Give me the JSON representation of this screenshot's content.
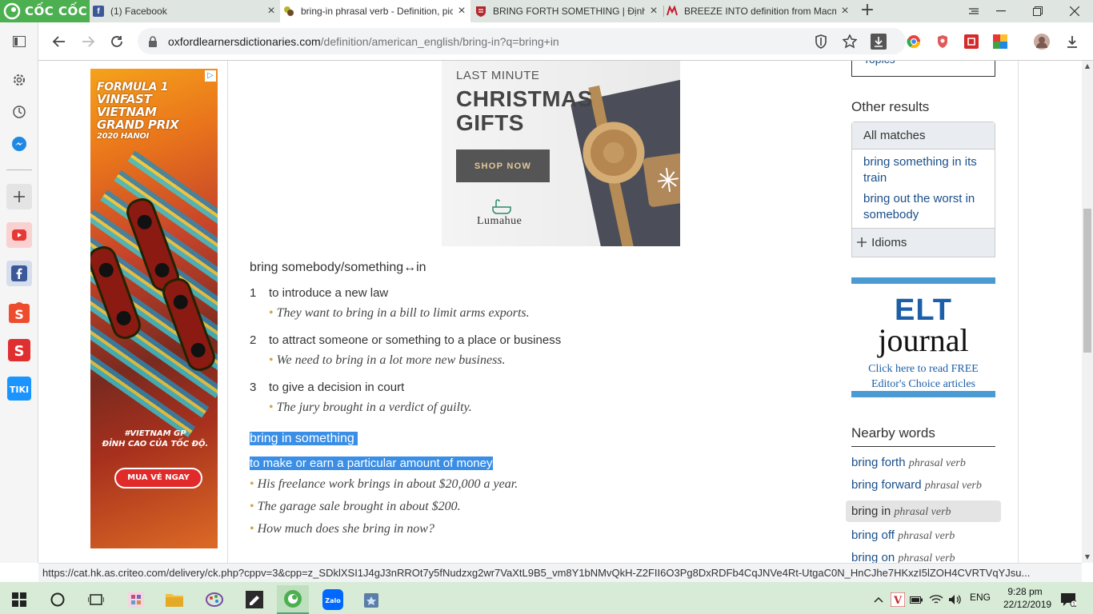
{
  "browser": {
    "brand": "CỐC CỐC",
    "tabs": [
      {
        "title": "(1) Facebook",
        "favicon": "facebook-icon",
        "active": false
      },
      {
        "title": "bring-in phrasal verb - Definition, pictures, pronunciation",
        "favicon": "oxford-icon",
        "active": true
      },
      {
        "title": "BRING FORTH SOMETHING | Định nghĩa",
        "favicon": "cambridge-icon",
        "active": false
      },
      {
        "title": "BREEZE INTO definition from Macmillan",
        "favicon": "macmillan-icon",
        "active": false
      }
    ],
    "url_domain": "oxfordlearnersdictionaries.com",
    "url_path": "/definition/american_english/bring-in?q=bring+in",
    "status_url": "https://cat.hk.as.criteo.com/delivery/ck.php?cppv=3&cpp=z_SDklXSI1J4gJ3nRROt7y5fNudzxg2wr7VaXtL9B5_vm8Y1bNMvQkH-Z2FII6O3Pg8DxRDFb4CqJNVe4Rt-UtgaC0N_HnCJhe7HKxzI5lZOH4CVRTVqYJsu..."
  },
  "ads": {
    "f1": {
      "title_lines": [
        "FORMULA 1",
        "VINFAST",
        "VIETNAM",
        "GRAND PRIX",
        "2020 HANOI"
      ],
      "tagline": "#VIETNAM GP\nĐỈNH CAO CỦA TỐC ĐỘ.",
      "cta": "MUA VÉ NGAY"
    },
    "xmas": {
      "line1": "LAST MINUTE",
      "line2": "CHRISTMAS GIFTS",
      "button": "SHOP NOW",
      "brand": "Lumahue"
    }
  },
  "entry": {
    "pv1": {
      "headword": "bring somebody/something↔in",
      "senses": [
        {
          "num": "1",
          "def": "to introduce a new law",
          "example": "They want to bring in a bill to limit arms exports."
        },
        {
          "num": "2",
          "def": "to attract someone or something to a place or business",
          "example": "We need to bring in a lot more new business."
        },
        {
          "num": "3",
          "def": "to give a decision in court",
          "example": "The jury brought in a verdict of guilty."
        }
      ]
    },
    "pv2": {
      "headword": "bring in something",
      "def": "to make or earn a particular amount of money",
      "examples": [
        "His freelance work brings in about $20,000 a year.",
        "The garage sale brought in about $200.",
        "How much does she bring in now?"
      ]
    }
  },
  "right": {
    "topics_label": "Topics",
    "other_results_heading": "Other results",
    "all_matches": "All matches",
    "matches": [
      "bring something in its train",
      "bring out the worst in somebody"
    ],
    "idioms_label": "Idioms",
    "elt": {
      "line1": "ELT",
      "line2": "journal",
      "line3": "Click here to read FREE",
      "line4": "Editor's Choice articles"
    },
    "nearby_heading": "Nearby words",
    "nearby": [
      {
        "word": "bring forth",
        "pos": "phrasal verb",
        "current": false
      },
      {
        "word": "bring forward",
        "pos": "phrasal verb",
        "current": false
      },
      {
        "word": "bring in",
        "pos": "phrasal verb",
        "current": true
      },
      {
        "word": "bring off",
        "pos": "phrasal verb",
        "current": false
      },
      {
        "word": "bring on",
        "pos": "phrasal verb",
        "current": false
      }
    ]
  },
  "taskbar": {
    "time": "9:28 pm",
    "date": "22/12/2019",
    "lang": "ENG"
  }
}
